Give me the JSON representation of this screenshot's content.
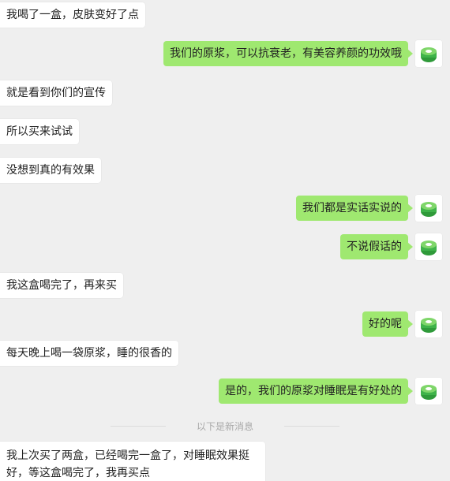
{
  "messages": [
    {
      "side": "in",
      "text": "我喝了一盒，皮肤变好了点"
    },
    {
      "side": "out",
      "text": "我们的原浆，可以抗衰老，有美容养颜的功效哦"
    },
    {
      "side": "in",
      "text": "就是看到你们的宣传"
    },
    {
      "side": "in",
      "text": "所以买来试试"
    },
    {
      "side": "in",
      "text": "没想到真的有效果"
    },
    {
      "side": "out",
      "text": "我们都是实话实说的"
    },
    {
      "side": "out",
      "text": "不说假话的"
    },
    {
      "side": "in",
      "text": "我这盒喝完了，再来买"
    },
    {
      "side": "out",
      "text": "好的呢"
    },
    {
      "side": "in",
      "text": "每天晚上喝一袋原浆，睡的很香的"
    },
    {
      "side": "out",
      "text": "是的，我们的原浆对睡眠是有好处的"
    },
    {
      "side": "in",
      "text": "我上次买了两盒，已经喝完一盒了，对睡眠效果挺好，等这盒喝完了，我再买点"
    }
  ],
  "divider": {
    "text": "以下是新消息"
  },
  "colors": {
    "outgoing_bubble": "#9fe870",
    "incoming_bubble": "#ffffff",
    "background": "#efefef"
  },
  "avatar_icon": "green-cake-avatar-icon"
}
